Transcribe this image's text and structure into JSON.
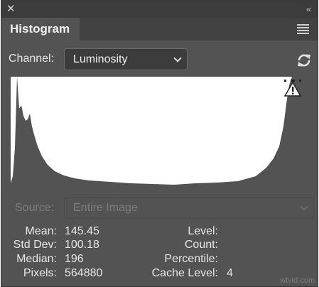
{
  "panel": {
    "close_icon": "close-icon",
    "collapse_icon": "collapse-icon",
    "menu_icon": "panel-menu-icon",
    "tab_label": "Histogram"
  },
  "channel": {
    "label": "Channel:",
    "value": "Luminosity",
    "refresh_icon": "refresh-icon"
  },
  "histogram": {
    "warning_icon": "cached-data-warning-icon",
    "fill_color": "#535353",
    "background_color": "#ffffff"
  },
  "source": {
    "label": "Source:",
    "value": "Entire Image"
  },
  "stats": {
    "mean_label": "Mean:",
    "mean": "145.45",
    "std_dev_label": "Std Dev:",
    "std_dev": "100.18",
    "median_label": "Median:",
    "median": "196",
    "pixels_label": "Pixels:",
    "pixels": "564880",
    "level_label": "Level:",
    "level": "",
    "count_label": "Count:",
    "count": "",
    "percentile_label": "Percentile:",
    "percentile": "",
    "cache_level_label": "Cache Level:",
    "cache_level": "4"
  },
  "watermark": "wtvid.com"
}
